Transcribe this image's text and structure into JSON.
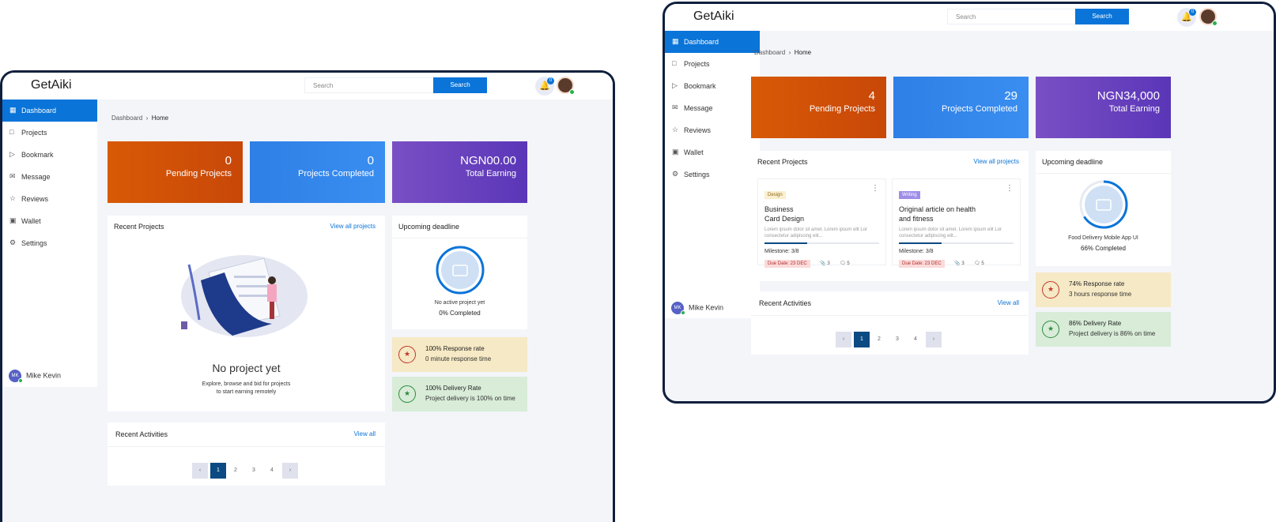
{
  "app": {
    "name": "GetAiki"
  },
  "search": {
    "placeholder": "Search",
    "button": "Search"
  },
  "notifications": {
    "count": "0"
  },
  "sidebar": {
    "items": [
      {
        "label": "Dashboard"
      },
      {
        "label": "Projects"
      },
      {
        "label": "Bookmark"
      },
      {
        "label": "Message"
      },
      {
        "label": "Reviews"
      },
      {
        "label": "Wallet"
      },
      {
        "label": "Settings"
      }
    ],
    "user": {
      "initials": "MK",
      "name": "Mike Kevin"
    }
  },
  "breadcrumb": {
    "root": "Dashboard",
    "current": "Home"
  },
  "section_titles": {
    "recent_projects": "Recent Projects",
    "view_all_projects": "View all  projects",
    "upcoming": "Upcoming deadline",
    "recent_activities": "Recent Activities",
    "view_all": "View all"
  },
  "pagination": {
    "pages": [
      "1",
      "2",
      "3",
      "4"
    ],
    "prev": "‹",
    "next": "›"
  },
  "screenA": {
    "stats": [
      {
        "value": "0",
        "label": "Pending Projects"
      },
      {
        "value": "0",
        "label": "Projects Completed"
      },
      {
        "value": "NGN00.00",
        "label": "Total Earning"
      }
    ],
    "empty": {
      "title": "No project yet",
      "text_line1": "Explore, browse and bid for projects",
      "text_line2": "to start earning remotely"
    },
    "deadline": {
      "project": "No active project yet",
      "progress_text": "0% Completed",
      "progress": 0
    },
    "response": {
      "title": "100% Response rate",
      "subtitle": "0 minute response time"
    },
    "delivery": {
      "title": "100% Delivery Rate",
      "subtitle": "Project delivery is 100% on time"
    }
  },
  "screenB": {
    "stats": [
      {
        "value": "4",
        "label": "Pending Projects"
      },
      {
        "value": "29",
        "label": "Projects Completed"
      },
      {
        "value": "NGN34,000",
        "label": "Total Earning"
      }
    ],
    "projects": [
      {
        "tag": "Design",
        "title_line1": "Business",
        "title_line2": "Card Design",
        "desc": "Lorem ipsum dolor sit amet. Lorem ipsum elit Lor consectetur adipiscing elit...",
        "milestone": "Milestone:  3/8",
        "progress": 0.375,
        "due": "Due Date: 23 DEC",
        "attachments": "3",
        "comments": "5"
      },
      {
        "tag": "Writing",
        "title_line1": "Original article on health",
        "title_line2": "and fitness",
        "desc": "Lorem ipsum dolor sit amet. Lorem ipsum elit Lor consectetur adipiscing elit...",
        "milestone": "Milestone:  3/8",
        "progress": 0.375,
        "due": "Due Date: 23 DEC",
        "attachments": "3",
        "comments": "5"
      }
    ],
    "deadline": {
      "project": "Food Delivery Mobile App UI",
      "progress_text": "66% Completed",
      "progress": 0.66
    },
    "response": {
      "title": "74% Response rate",
      "subtitle": "3 hours response time"
    },
    "delivery": {
      "title": "86% Delivery Rate",
      "subtitle": "Project delivery is 86% on time"
    }
  },
  "colors": {
    "accent": "#0a74d8",
    "orange": "#d85a06",
    "blue": "#2e7fe6",
    "purple": "#6a44bf",
    "navy": "#0b4a82"
  },
  "icons": [
    "grid-icon",
    "briefcase-icon",
    "bookmark-icon",
    "mail-icon",
    "star-icon",
    "wallet-icon",
    "gear-icon",
    "bell-icon",
    "chevron-right-icon",
    "kebab-icon",
    "paperclip-icon",
    "comment-icon"
  ]
}
